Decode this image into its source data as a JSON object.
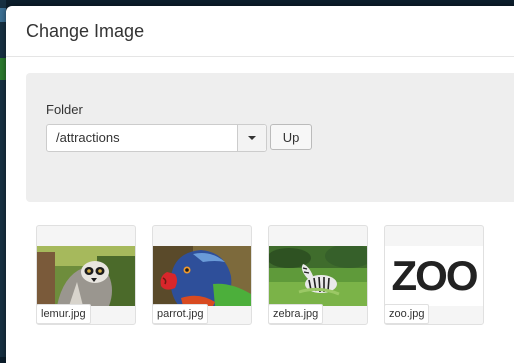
{
  "modal": {
    "title": "Change Image"
  },
  "folder": {
    "label": "Folder",
    "selected": "/attractions",
    "up_label": "Up"
  },
  "images": [
    {
      "filename": "lemur.jpg"
    },
    {
      "filename": "parrot.jpg"
    },
    {
      "filename": "zebra.jpg"
    },
    {
      "filename": "zoo.jpg",
      "logo_text": "ZOO"
    }
  ]
}
